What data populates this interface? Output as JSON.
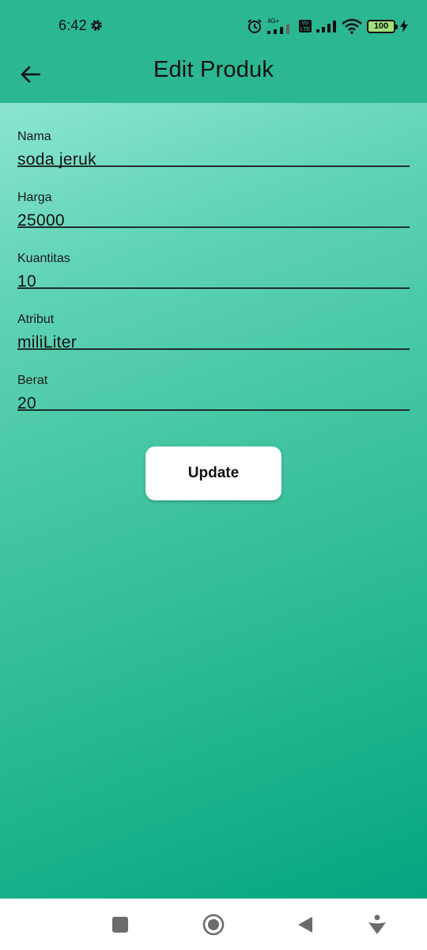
{
  "status_bar": {
    "time": "6:42",
    "network_label": "4G+",
    "volte_label": "Vo LTE",
    "battery": "100"
  },
  "app_bar": {
    "title": "Edit Produk",
    "back_icon": "arrow-left-icon"
  },
  "form": {
    "fields": [
      {
        "label": "Nama",
        "value": "soda jeruk"
      },
      {
        "label": "Harga",
        "value": "25000"
      },
      {
        "label": "Kuantitas",
        "value": "10"
      },
      {
        "label": "Atribut",
        "value": "miliLiter"
      },
      {
        "label": "Berat",
        "value": "20"
      }
    ],
    "submit_label": "Update"
  },
  "nav_bar": {
    "icons": [
      "square-icon",
      "home-circle-icon",
      "back-triangle-icon",
      "accessibility-icon"
    ]
  },
  "colors": {
    "app_bar": "#2bb791",
    "gradient_start": "#8be5cf",
    "gradient_end": "#04a680"
  }
}
